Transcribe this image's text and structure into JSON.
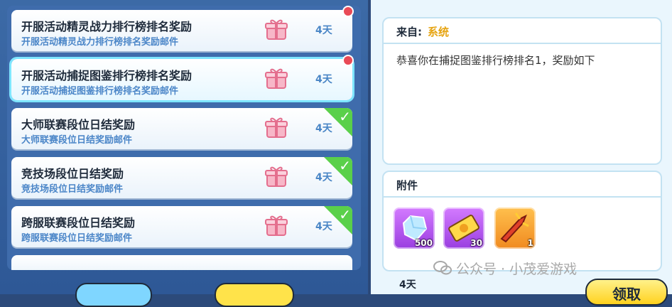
{
  "mail_list": {
    "items": [
      {
        "title": "开服活动精灵战力排行榜排名奖励",
        "subtitle": "开服活动精灵战力排行榜排名奖励邮件",
        "days": "4天",
        "unread": true,
        "claimed": false,
        "selected": false
      },
      {
        "title": "开服活动捕捉图鉴排行榜排名奖励",
        "subtitle": "开服活动捕捉图鉴排行榜排名奖励邮件",
        "days": "4天",
        "unread": true,
        "claimed": false,
        "selected": true
      },
      {
        "title": "大师联赛段位日结奖励",
        "subtitle": "大师联赛段位日结奖励邮件",
        "days": "4天",
        "unread": false,
        "claimed": true,
        "selected": false
      },
      {
        "title": "竞技场段位日结奖励",
        "subtitle": "竞技场段位日结奖励邮件",
        "days": "4天",
        "unread": false,
        "claimed": true,
        "selected": false
      },
      {
        "title": "跨服联赛段位日结奖励",
        "subtitle": "跨服联赛段位日结奖励邮件",
        "days": "4天",
        "unread": false,
        "claimed": true,
        "selected": false
      }
    ]
  },
  "detail": {
    "from_label": "来自:",
    "from_name": "系统",
    "body": "恭喜你在捕捉图鉴排行榜排名1，奖励如下",
    "attachments_label": "附件",
    "attachments": [
      {
        "icon": "crystal-icon",
        "count": "500",
        "rarity_color": "#b55cf0"
      },
      {
        "icon": "ticket-icon",
        "count": "30",
        "rarity_color": "#b55cf0"
      },
      {
        "icon": "weapon-icon",
        "count": "1",
        "rarity_color": "#f5a83a"
      }
    ],
    "expire": "4天",
    "claim_button": "领取"
  },
  "watermark": "公众号 · 小茂爱游戏",
  "colors": {
    "accent_yellow": "#ffd21f",
    "unread_dot": "#e94a56",
    "claimed_check": "#5ad04a",
    "panel_blue": "#3f6cac"
  }
}
